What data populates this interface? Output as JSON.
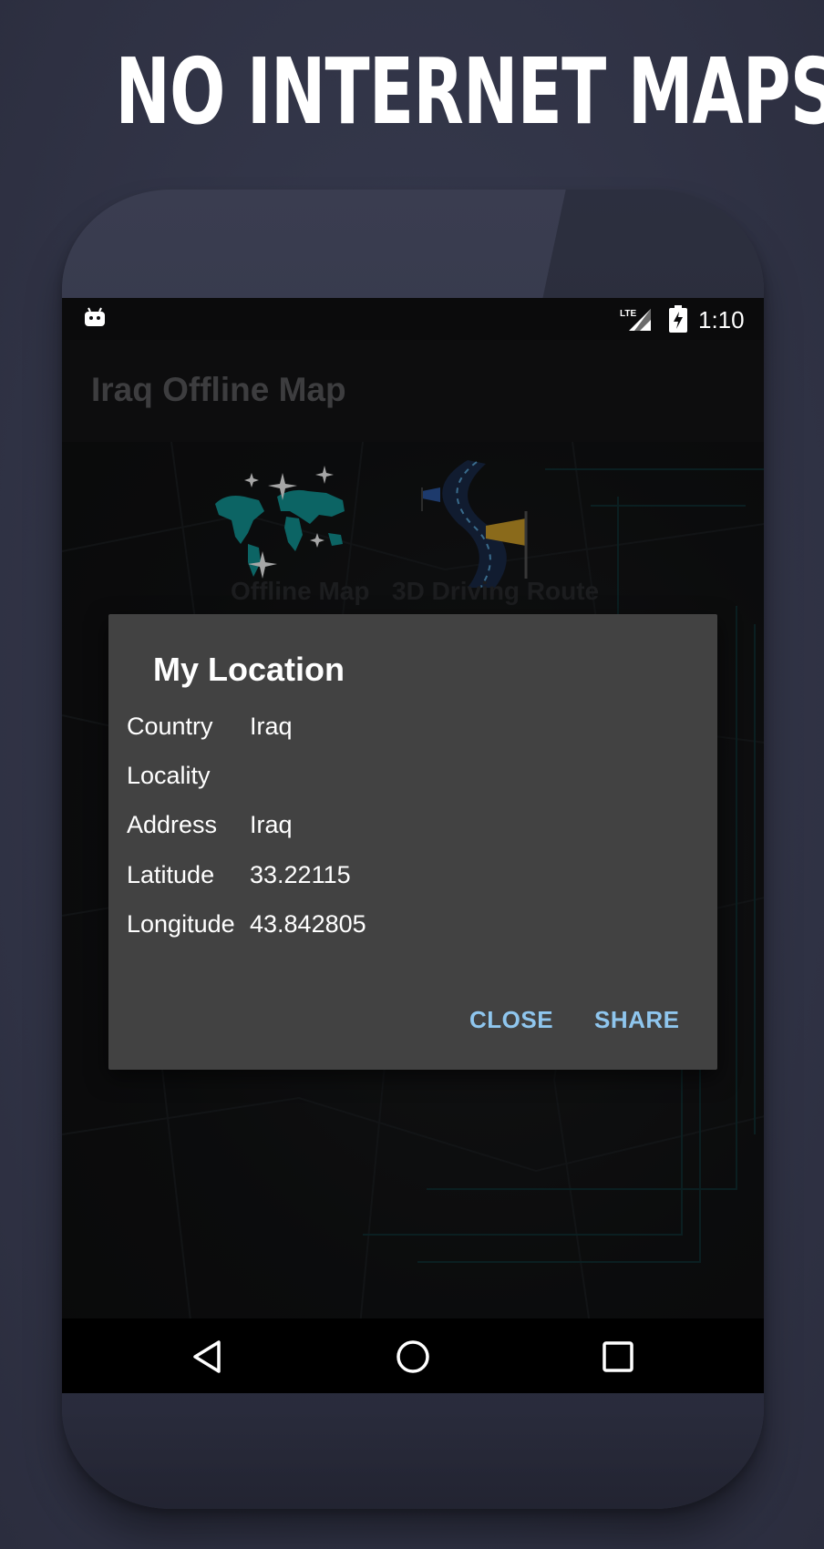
{
  "promo": {
    "title": "NO INTERNET MAPS"
  },
  "statusbar": {
    "time": "1:10",
    "icons": [
      "android-debug-icon",
      "lte-signal-icon",
      "battery-charging-icon"
    ]
  },
  "appbar": {
    "title": "Iraq Offline Map"
  },
  "background": {
    "tiles": [
      {
        "icon": "world-map-icon"
      },
      {
        "icon": "route-flag-icon"
      }
    ]
  },
  "dialog": {
    "title": "My Location",
    "rows": [
      {
        "label": "Country",
        "value": "Iraq"
      },
      {
        "label": "Locality",
        "value": ""
      },
      {
        "label": "Address",
        "value": "Iraq"
      },
      {
        "label": "Latitude",
        "value": "33.22115"
      },
      {
        "label": "Longitude",
        "value": "43.842805"
      }
    ],
    "buttons": {
      "close": "CLOSE",
      "share": "SHARE"
    }
  },
  "navbar": {
    "icons": [
      "back-icon",
      "home-icon",
      "recents-icon"
    ]
  },
  "colors": {
    "accent": "#8fc6ee",
    "dialog_bg": "#424242",
    "page_bg": "#333649"
  }
}
